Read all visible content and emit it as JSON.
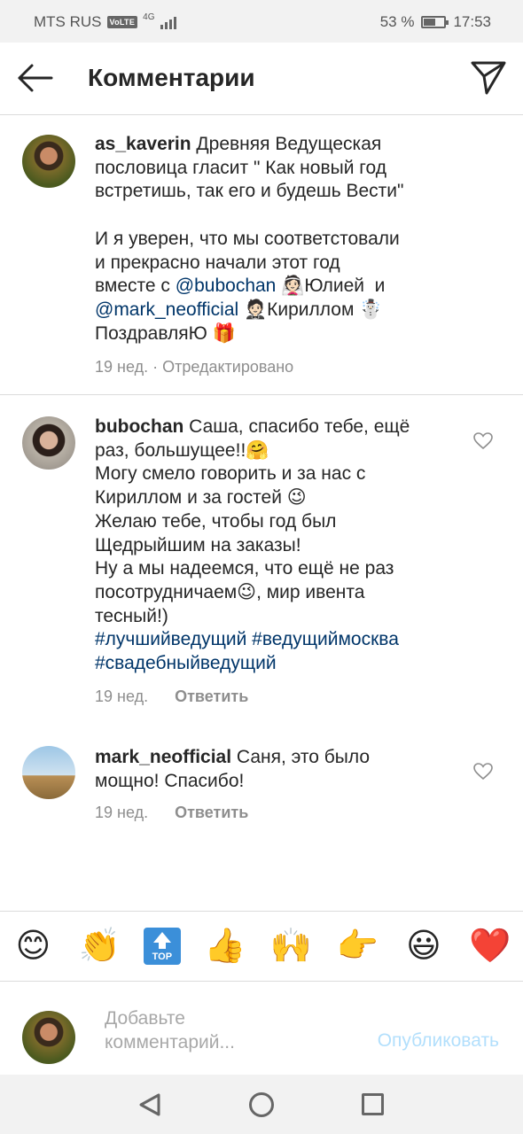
{
  "status_bar": {
    "carrier": "MTS RUS",
    "volte": "VoLTE",
    "network": "4G",
    "battery_percent": "53 %",
    "battery_level": 0.53,
    "time": "17:53"
  },
  "header": {
    "title": "Комментарии",
    "back_icon": "arrow-left-icon",
    "send_icon": "paper-plane-icon"
  },
  "comments": [
    {
      "username": "as_kaverin",
      "text_1": " Древняя Ведущеская\nпословица гласит \" Как новый год\nвстретишь, так его и будешь Вести\"\n\nИ я уверен, что мы соответстовали\nи прекрасно начали этот год\nвместе с ",
      "mention_1": "@bubochan",
      "text_2": " 👰🏻Юлией  и\n",
      "mention_2": "@mark_neofficial",
      "text_3": " 🤵🏻Кириллом ☃️\nПоздравляЮ 🎁",
      "time": "19 нед.",
      "edited": " · Отредактировано"
    },
    {
      "username": "bubochan",
      "text_1": " Саша, спасибо тебе, ещё\nраз, большущее!!🤗\nМогу смело говорить и за нас с\nКириллом и за гостей 😉\nЖелаю тебе, чтобы год был\nЩедрыйшим на заказы!\nНу а мы надеемся, что ещё не раз\nпосотрудничаем😉, мир ивента\nтесный!)\n",
      "hashtag_1": "#лучшийведущий",
      "hashtag_2": "#ведущиймосква",
      "hashtag_3": "#свадебныйведущий",
      "time": "19 нед.",
      "reply_label": "Ответить"
    },
    {
      "username": "mark_neofficial",
      "text_1": " Саня, это было\nмощно! Спасибо!",
      "time": "19 нед.",
      "reply_label": "Ответить"
    }
  ],
  "emoji_bar": {
    "items": [
      "😊",
      "👏",
      "TOP",
      "👍",
      "🙌",
      "👉",
      "😃",
      "❤️"
    ]
  },
  "composer": {
    "placeholder": "Добавьте\nкомментарий...",
    "publish_label": "Опубликовать"
  },
  "colors": {
    "link": "#003569",
    "muted": "#8e8e8e",
    "publish_disabled": "#b2dffc"
  }
}
